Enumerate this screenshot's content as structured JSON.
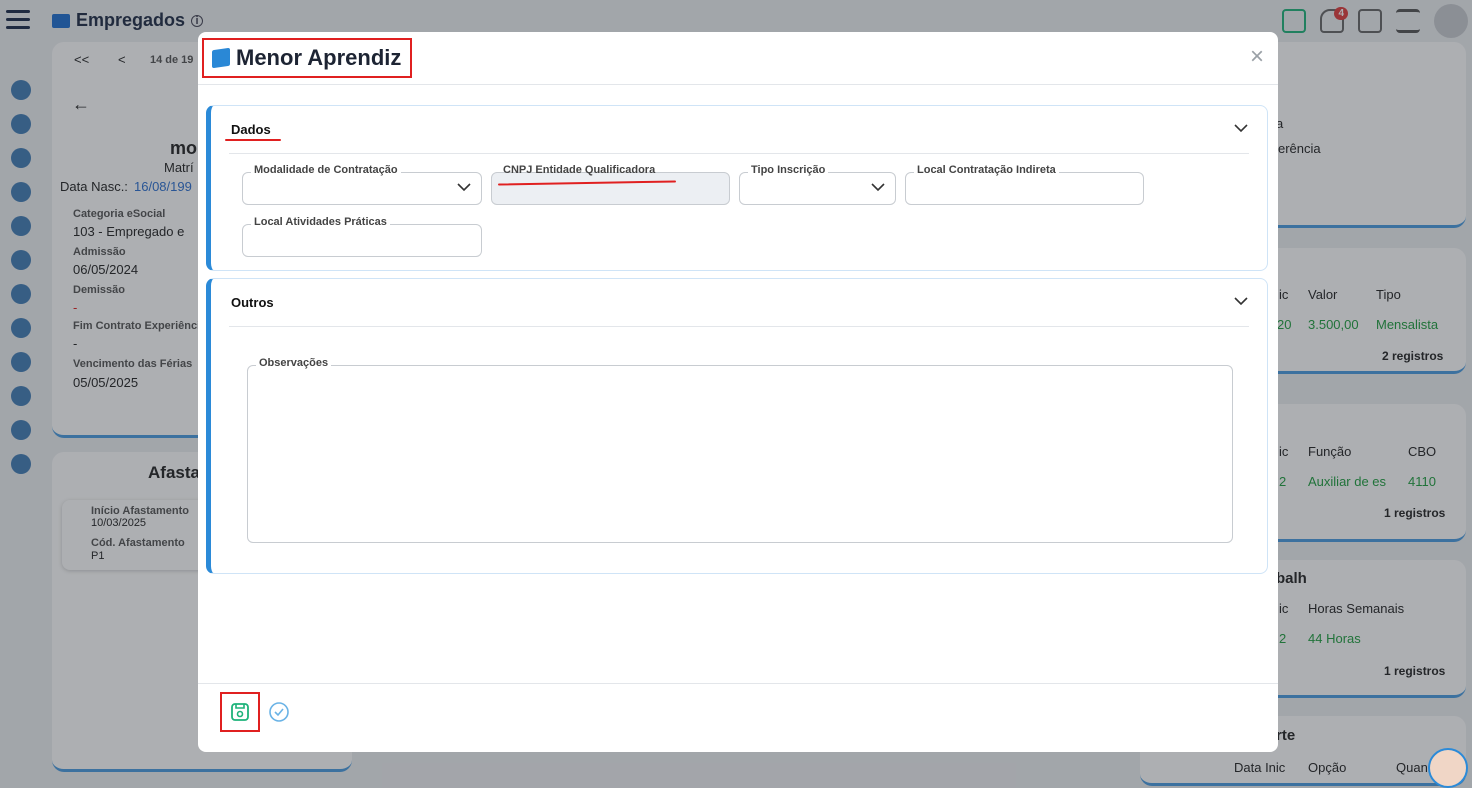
{
  "app": {
    "title": "Empregados",
    "notification_count": "4"
  },
  "background": {
    "pager": "14 de 19",
    "employee_name": "mo",
    "matricula_label": "Matrí",
    "birth_label": "Data Nasc.:",
    "birth_value": "16/08/199",
    "fields": [
      {
        "label": "Categoria eSocial",
        "value": "103 - Empregado e"
      },
      {
        "label": "Admissão",
        "value": "06/05/2024"
      },
      {
        "label": "Demissão",
        "value": "-"
      },
      {
        "label": "Fim Contrato Experiência",
        "value": "-"
      },
      {
        "label": "Vencimento das Férias",
        "value": "05/05/2025"
      }
    ],
    "afast_title": "Afasta",
    "afast_inicio_label": "Início Afastamento",
    "afast_inicio_value": "10/03/2025",
    "afast_cod_label": "Cód. Afastamento",
    "afast_cod_value": "P1",
    "right_cards": {
      "c1_line1": "a",
      "c1_line2": "erência",
      "c2_headers": [
        "ic",
        "Valor",
        "Tipo"
      ],
      "c2_row": [
        "20",
        "3.500,00",
        "Mensalista"
      ],
      "c2_count": "2 registros",
      "c3_headers": [
        "ic",
        "Função",
        "CBO"
      ],
      "c3_row": [
        "2",
        "Auxiliar de es",
        "4110"
      ],
      "c3_count": "1 registros",
      "c4_title": "balh",
      "c4_headers": [
        "ic",
        "Horas Semanais"
      ],
      "c4_row": [
        "2",
        "44 Horas"
      ],
      "c4_count": "1 registros",
      "c5_title": "rte",
      "c5_headers": [
        "Data Inic",
        "Opção",
        "Quan"
      ]
    }
  },
  "modal": {
    "title": "Menor Aprendiz",
    "close_symbol": "×",
    "sections": {
      "dados": {
        "title": "Dados",
        "fields": {
          "modalidade": "Modalidade de Contratação",
          "cnpj": "CNPJ Entidade Qualificadora",
          "tipo_inscricao": "Tipo Inscrição",
          "local_indireta": "Local Contratação Indireta",
          "local_atividades": "Local Atividades Práticas"
        }
      },
      "outros": {
        "title": "Outros",
        "fields": {
          "observacoes": "Observações"
        }
      }
    }
  },
  "colors": {
    "accent": "#2b8ad8",
    "highlight": "#e02020",
    "save_icon": "#1db37a"
  }
}
